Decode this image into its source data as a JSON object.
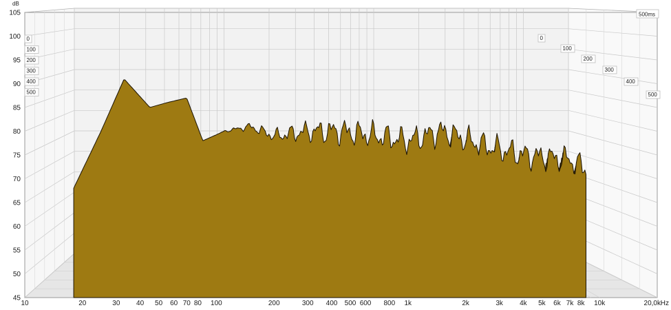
{
  "chart_data": {
    "type": "area",
    "style": "waterfall",
    "y_unit": "dB",
    "x_unit": "Hz",
    "time_max_label": "500ms",
    "ylim": [
      45,
      105
    ],
    "y_ticks": [
      "105",
      "100",
      "95",
      "90",
      "85",
      "80",
      "75",
      "70",
      "65",
      "60",
      "55",
      "50",
      "45"
    ],
    "x_ticks": [
      {
        "f": 10,
        "label": "10"
      },
      {
        "f": 20,
        "label": "20"
      },
      {
        "f": 30,
        "label": "30"
      },
      {
        "f": 40,
        "label": "40"
      },
      {
        "f": 50,
        "label": "50"
      },
      {
        "f": 60,
        "label": "60"
      },
      {
        "f": 70,
        "label": "70"
      },
      {
        "f": 80,
        "label": "80"
      },
      {
        "f": 100,
        "label": "100"
      },
      {
        "f": 200,
        "label": "200"
      },
      {
        "f": 300,
        "label": "300"
      },
      {
        "f": 400,
        "label": "400"
      },
      {
        "f": 500,
        "label": "500"
      },
      {
        "f": 600,
        "label": "600"
      },
      {
        "f": 800,
        "label": "800"
      },
      {
        "f": 1000,
        "label": "1k"
      },
      {
        "f": 2000,
        "label": "2k"
      },
      {
        "f": 3000,
        "label": "3k"
      },
      {
        "f": 4000,
        "label": "4k"
      },
      {
        "f": 5000,
        "label": "5k"
      },
      {
        "f": 6000,
        "label": "6k"
      },
      {
        "f": 7000,
        "label": "7k"
      },
      {
        "f": 8000,
        "label": "8k"
      },
      {
        "f": 10000,
        "label": "10k"
      },
      {
        "f": 20000,
        "label": "20,0k"
      }
    ],
    "time_labels_left": [
      "0",
      "100",
      "200",
      "300",
      "400",
      "500"
    ],
    "time_labels_right": [
      "0",
      "100",
      "200",
      "300",
      "400",
      "500"
    ],
    "slices_ms": [
      0,
      500
    ],
    "front_slice": {
      "time_ms": 0,
      "freq_range_hz": [
        18,
        8500
      ],
      "points": [
        {
          "f": 18,
          "db": 68
        },
        {
          "f": 25,
          "db": 80
        },
        {
          "f": 33,
          "db": 91
        },
        {
          "f": 45,
          "db": 85
        },
        {
          "f": 55,
          "db": 86
        },
        {
          "f": 70,
          "db": 87
        },
        {
          "f": 85,
          "db": 78
        },
        {
          "f": 110,
          "db": 80
        },
        {
          "f": 150,
          "db": 81
        },
        {
          "f": 200,
          "db": 79
        },
        {
          "f": 300,
          "db": 80
        },
        {
          "f": 450,
          "db": 80
        },
        {
          "f": 700,
          "db": 79
        },
        {
          "f": 1000,
          "db": 78
        },
        {
          "f": 1500,
          "db": 80
        },
        {
          "f": 2500,
          "db": 77
        },
        {
          "f": 4000,
          "db": 75
        },
        {
          "f": 7000,
          "db": 74
        },
        {
          "f": 8500,
          "db": 72
        }
      ]
    },
    "colors": {
      "fill": "#9e7a12",
      "edge": "#1a1204",
      "grid": "#c8c8c8",
      "floor": "#e6e6e6"
    }
  }
}
